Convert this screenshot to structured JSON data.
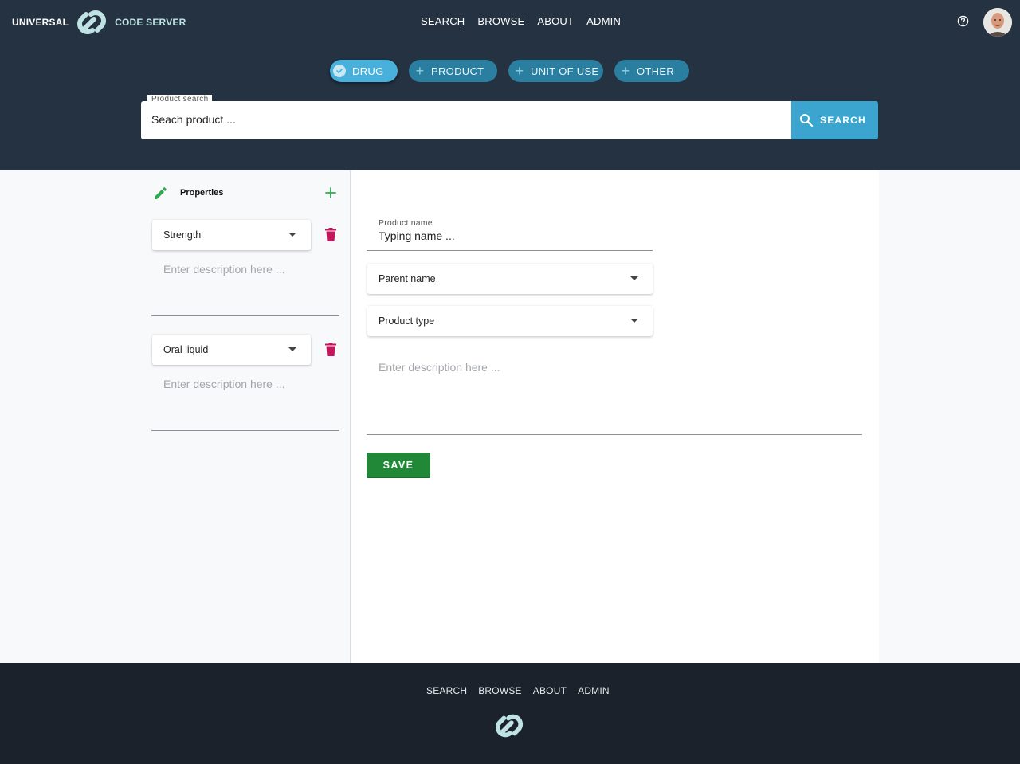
{
  "brand": {
    "left": "UNIVERSAL",
    "right": "CODE SERVER"
  },
  "nav": [
    {
      "label": "SEARCH"
    },
    {
      "label": "BROWSE"
    },
    {
      "label": "ABOUT"
    },
    {
      "label": "ADMIN"
    }
  ],
  "chips": [
    {
      "label": "DRUG",
      "selected": true
    },
    {
      "label": "PRODUCT",
      "selected": false
    },
    {
      "label": "UNIT OF USE",
      "selected": false
    },
    {
      "label": "OTHER",
      "selected": false
    }
  ],
  "search": {
    "label": "Product search",
    "placeholder": "Seach product ...",
    "button_label": "SEARCH"
  },
  "properties": {
    "title": "Properties",
    "items": [
      {
        "select_value": "Strength",
        "description_placeholder": "Enter description here ..."
      },
      {
        "select_value": "Oral liquid",
        "description_placeholder": "Enter description here ..."
      }
    ]
  },
  "form": {
    "product_name_label": "Product name",
    "product_name_value": "Typing name ...",
    "parent_name": "Parent name",
    "product_type": "Product type",
    "description_placeholder": "Enter description here ...",
    "save_label": "SAVE"
  },
  "footer": {
    "nav": [
      {
        "label": "SEARCH"
      },
      {
        "label": "BROWSE"
      },
      {
        "label": "ABOUT"
      },
      {
        "label": "ADMIN"
      }
    ]
  },
  "colors": {
    "header_bg": "#253242",
    "chip_selected": "#47b0db",
    "chip": "#2a7fa0",
    "search_button": "#3ba5cf",
    "save_button": "#218838",
    "delete_icon": "#c2185b",
    "footer_bg": "#1b222b",
    "logo": "#bfe3e4"
  },
  "icons": {
    "chip_selected": "check-circle-icon",
    "chip": "plus-icon",
    "search": "search-icon",
    "help": "help-circle-icon",
    "edit": "pencil-icon",
    "add": "plus-icon",
    "delete": "trash-icon",
    "dropdown": "caret-down-icon"
  }
}
